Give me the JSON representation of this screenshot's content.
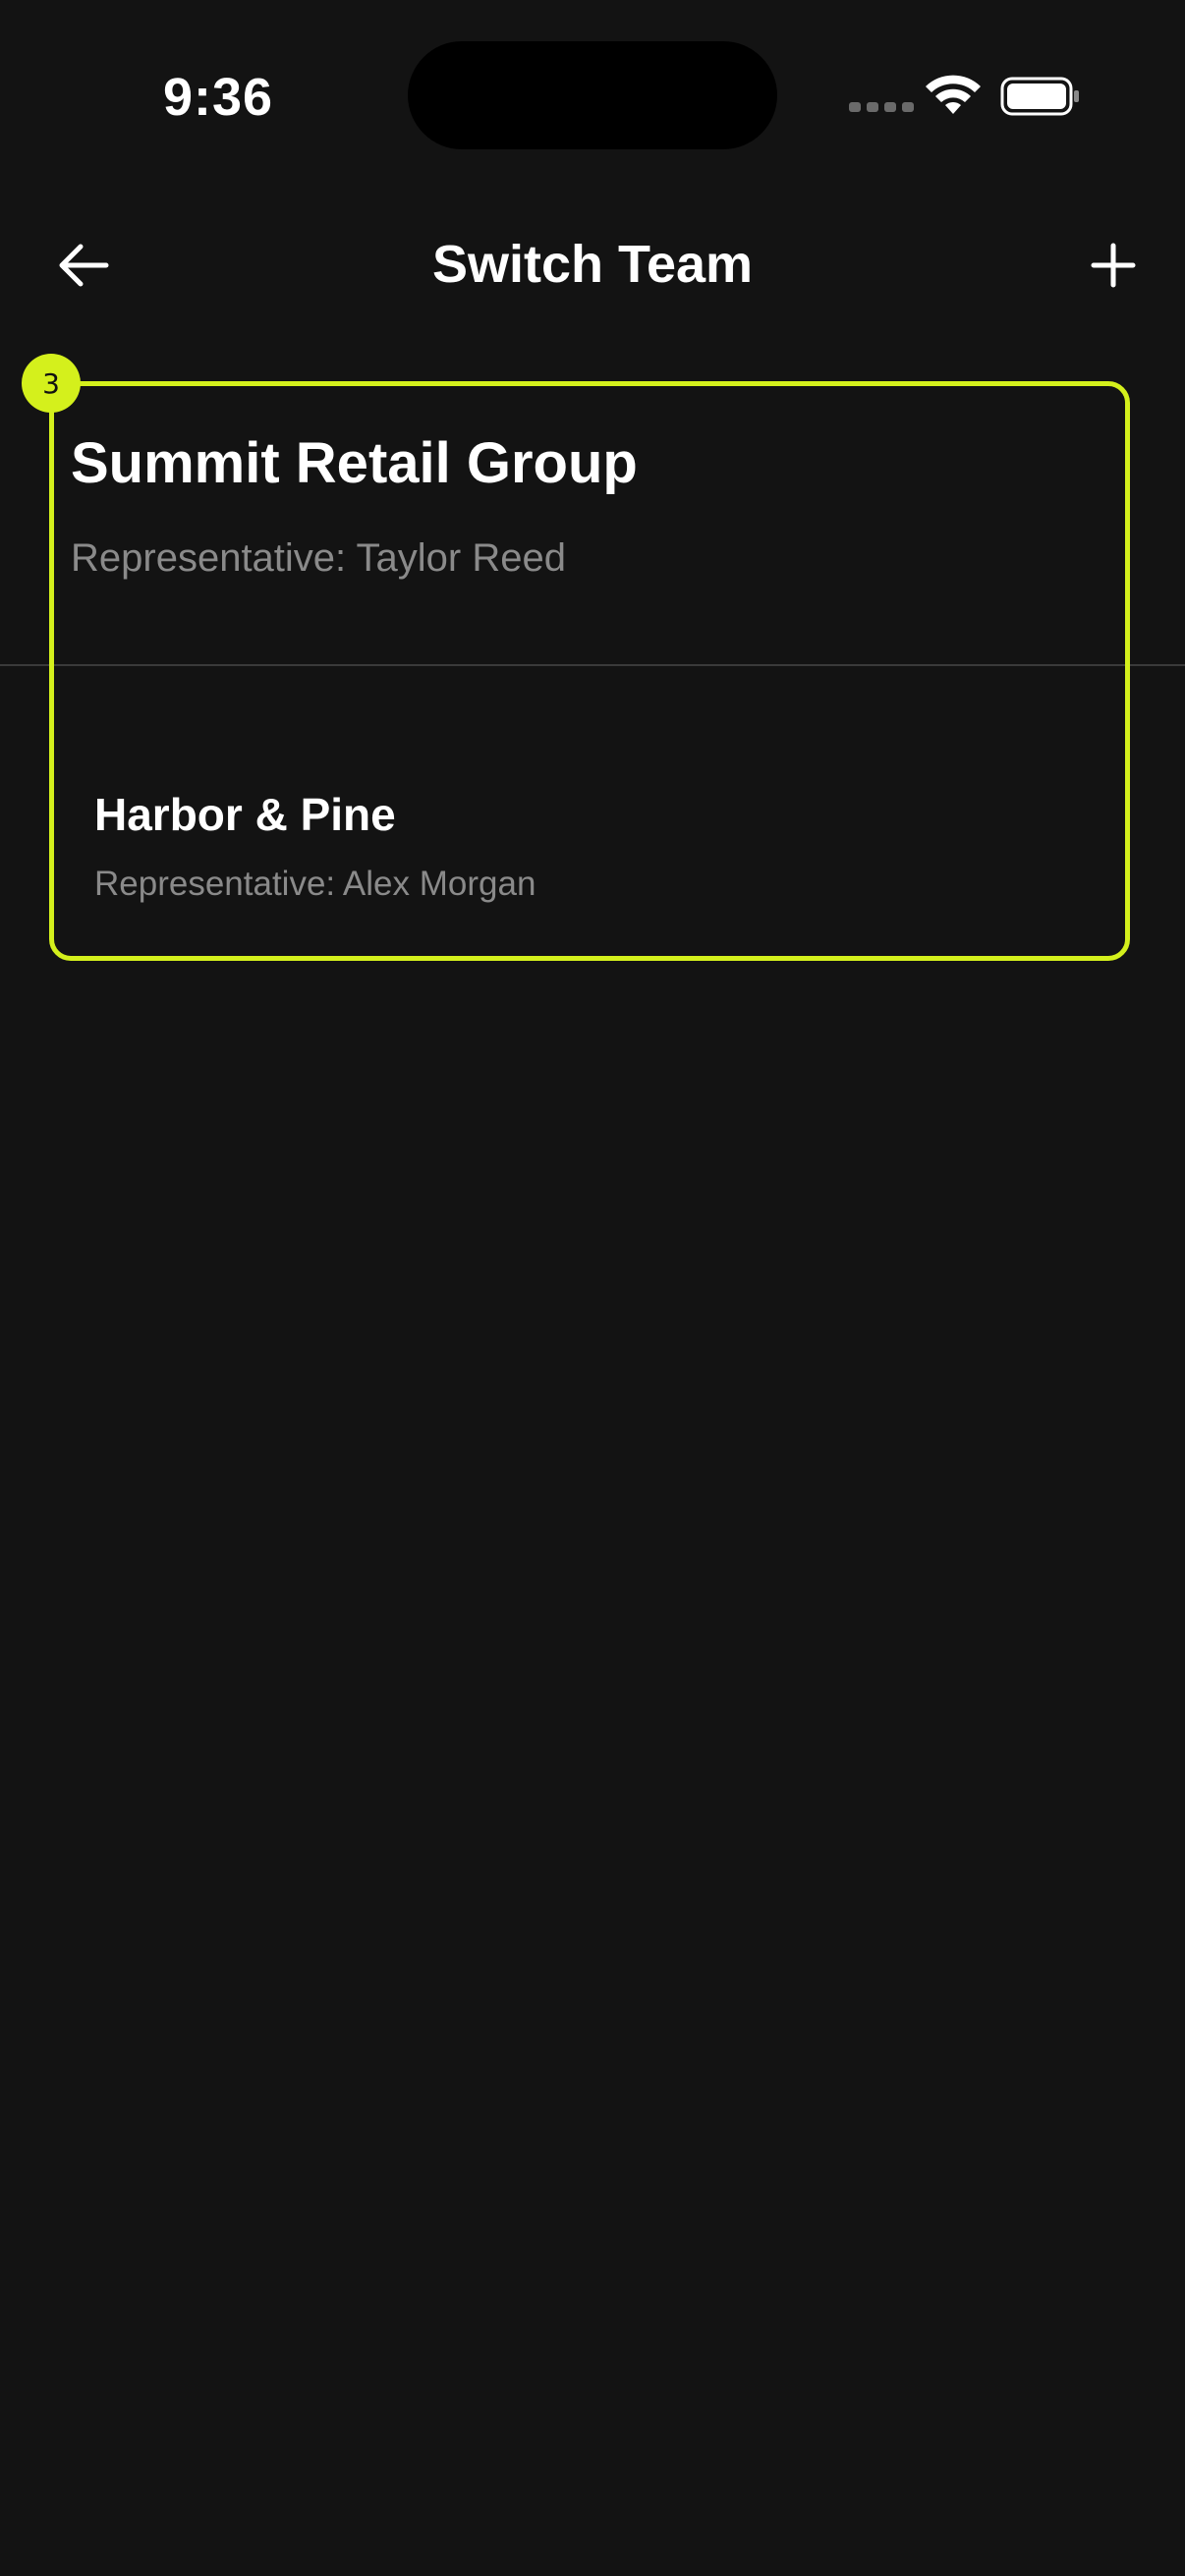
{
  "status_bar": {
    "time": "9:36",
    "icons": [
      "signal-icon",
      "wifi-icon",
      "battery-icon"
    ]
  },
  "header": {
    "title": "Switch Team",
    "back_icon": "arrow-left-icon",
    "add_icon": "plus-icon"
  },
  "current_team": {
    "name": "Summit Retail Group",
    "representative": "Representative: Taylor Reed"
  },
  "teams": [
    {
      "name": "Harbor & Pine",
      "representative": "Representative: Alex Morgan"
    }
  ],
  "overlay": {
    "badge_label": "3",
    "color": "#d4f01c"
  },
  "colors": {
    "background": "#131313",
    "text_primary": "#ffffff",
    "text_secondary": "#8a8a8a",
    "divider": "#3a3a3a"
  }
}
